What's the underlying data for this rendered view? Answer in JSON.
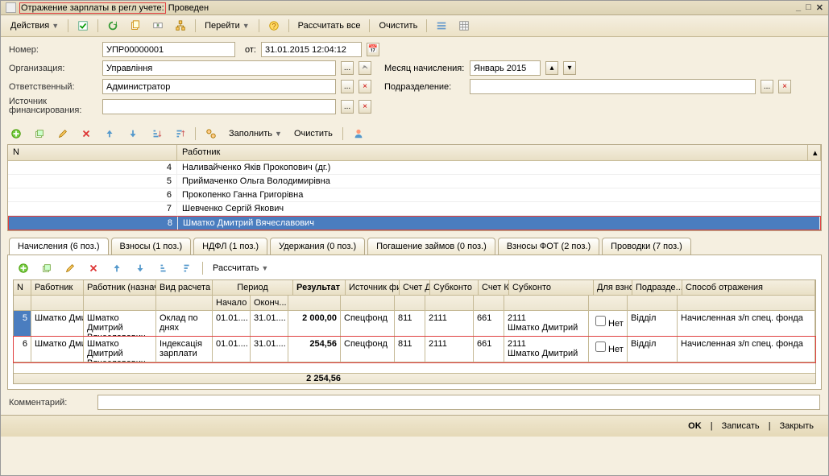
{
  "title": {
    "main": "Отражение зарплаты в регл учете:",
    "status": "Проведен"
  },
  "toolbar": {
    "actions": "Действия",
    "go": "Перейти",
    "calc": "Рассчитать все",
    "clear": "Очистить"
  },
  "form": {
    "number_label": "Номер:",
    "number": "УПР00000001",
    "date_label": "от:",
    "date": "31.01.2015 12:04:12",
    "org_label": "Организация:",
    "org": "Управління",
    "month_label": "Месяц начисления:",
    "month": "Январь 2015",
    "resp_label": "Ответственный:",
    "resp": "Администратор",
    "dept_label": "Подразделение:",
    "dept": "",
    "fund_label": "Источник финансирования:",
    "fund": ""
  },
  "subtb": {
    "fill": "Заполнить",
    "clear": "Очистить"
  },
  "grid1": {
    "h_n": "N",
    "h_worker": "Работник",
    "rows": [
      {
        "n": "4",
        "name": "Наливайченко Яків Прокопович (дг.)"
      },
      {
        "n": "5",
        "name": "Приймаченко Ольга Володимирівна"
      },
      {
        "n": "6",
        "name": "Прокопенко Ганна Григорівна"
      },
      {
        "n": "7",
        "name": "Шевченко Сергій Якович"
      },
      {
        "n": "8",
        "name": "Шматко Дмитрий Вячеславович"
      }
    ]
  },
  "tabs": {
    "t0": "Начисления (6 поз.)",
    "t1": "Взносы (1 поз.)",
    "t2": "НДФЛ (1 поз.)",
    "t3": "Удержания (0 поз.)",
    "t4": "Погашение займов (0 поз.)",
    "t5": "Взносы ФОТ (2 поз.)",
    "t6": "Проводки (7 поз.)"
  },
  "subtb2": {
    "calc": "Рассчитать"
  },
  "grid2": {
    "h": {
      "n": "N",
      "worker": "Работник",
      "worker2": "Работник (назначение)",
      "type": "Вид расчета",
      "period": "Период",
      "start": "Начало",
      "end": "Оконч...",
      "result": "Результат",
      "fund": "Источник финансир...",
      "dt": "Счет Дт",
      "sub1": "Субконто",
      "kt": "Счет Кт",
      "sub2": "Субконто",
      "contr": "Для взнос...",
      "dept": "Подразде... организа...",
      "method": "Способ отражения"
    },
    "rows": [
      {
        "n": "5",
        "w1": "Шматко Дмитр...",
        "w2": "Шматко Дмитрий Вячеславович",
        "type": "Оклад по днях",
        "start": "01.01....",
        "end": "31.01....",
        "res": "2 000,00",
        "fund": "Спецфонд",
        "dt": "811",
        "sub1": "2111",
        "kt": "661",
        "sub2a": "2111",
        "sub2b": "Шматко Дмитрий ...",
        "contr": "Нет",
        "dept": "Відділ",
        "method": "Начисленная з/п спец. фонда"
      },
      {
        "n": "6",
        "w1": "Шматко Дмитр...",
        "w2": "Шматко Дмитрий Вячеславович",
        "type": "Індексація зарплати",
        "start": "01.01....",
        "end": "31.01....",
        "res": "254,56",
        "fund": "Спецфонд",
        "dt": "811",
        "sub1": "2111",
        "kt": "661",
        "sub2a": "2111",
        "sub2b": "Шматко Дмитрий ...",
        "contr": "Нет",
        "dept": "Відділ",
        "method": "Начисленная з/п спец. фонда"
      }
    ],
    "total": "2 254,56"
  },
  "comment_label": "Комментарий:",
  "footer": {
    "ok": "OK",
    "save": "Записать",
    "close": "Закрыть"
  }
}
